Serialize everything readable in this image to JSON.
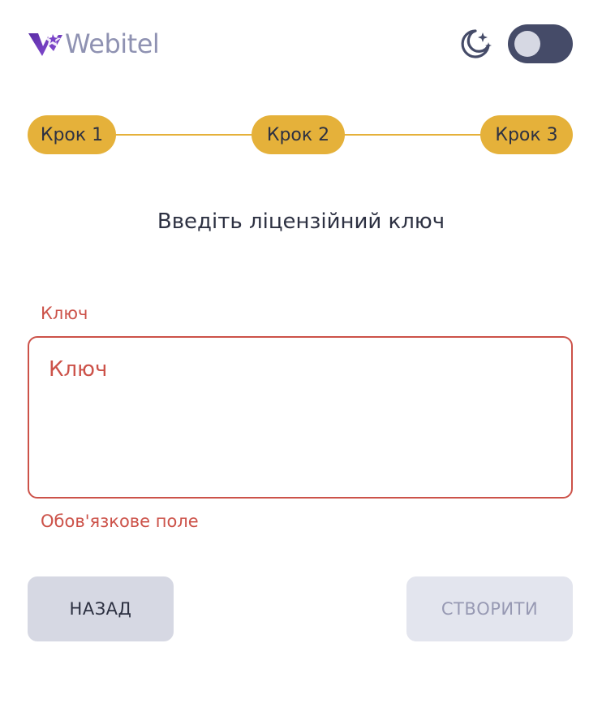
{
  "header": {
    "logo_text": "Webitel",
    "theme_icon": "moon-stars-icon",
    "theme_toggle": {
      "on": false
    }
  },
  "stepper": {
    "steps": [
      {
        "label": "Крок 1"
      },
      {
        "label": "Крок 2"
      },
      {
        "label": "Крок 3"
      }
    ]
  },
  "form": {
    "title": "Введіть ліцензійний ключ",
    "key_field": {
      "label": "Ключ",
      "placeholder": "Ключ",
      "value": "",
      "error": "Обов'язкове поле"
    }
  },
  "actions": {
    "back_label": "НАЗАД",
    "create_label": "СТВОРИТИ"
  },
  "colors": {
    "accent": "#e5b13a",
    "error": "#cc5249",
    "text": "#2d3142",
    "toggle": "#454b68",
    "logo_text": "#8f92b2",
    "button_secondary": "#d6d8e3",
    "button_disabled": "#e3e5ee"
  }
}
